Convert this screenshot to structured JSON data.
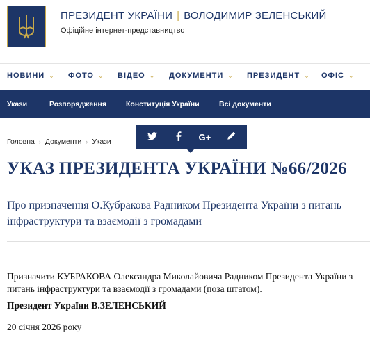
{
  "site": {
    "name_left": "ПРЕЗИДЕНТ УКРАЇНИ",
    "separator": "|",
    "name_right": "ВОЛОДИМИР ЗЕЛЕНСЬКИЙ",
    "subtitle": "Офіційне інтернет-представництво",
    "logo_icon": "trident-coat-of-arms-icon"
  },
  "main_nav": [
    {
      "label": "НОВИНИ"
    },
    {
      "label": "ФОТО"
    },
    {
      "label": "ВІДЕО"
    },
    {
      "label": "ДОКУМЕНТИ"
    },
    {
      "label": "ПРЕЗИДЕНТ"
    },
    {
      "label": "ОФІС"
    }
  ],
  "sub_nav": [
    {
      "label": "Укази"
    },
    {
      "label": "Розпорядження"
    },
    {
      "label": "Конституція України"
    },
    {
      "label": "Всі документи"
    }
  ],
  "breadcrumb": [
    "Головна",
    "Документи",
    "Укази"
  ],
  "share_icons": [
    "twitter-icon",
    "facebook-icon",
    "google-plus-icon",
    "pencil-icon"
  ],
  "share_glyphs": {
    "google_plus": "G+"
  },
  "document": {
    "title": "УКАЗ ПРЕЗИДЕНТА УКРАЇНИ №66/2026",
    "lead": "Про призначення О.Кубракова Радником Президента України з питань інфраструктури та взаємодії з громадами",
    "body": "Призначити КУБРАКОВА Олександра Миколайовича Радником Президента України з питань інфраструктури та взаємодії з громадами (поза штатом).",
    "signature": "Президент України В.ЗЕЛЕНСЬКИЙ",
    "date": "20 січня 2026 року"
  },
  "colors": {
    "brand_blue": "#1d3567",
    "accent_gold": "#c8a94a"
  }
}
